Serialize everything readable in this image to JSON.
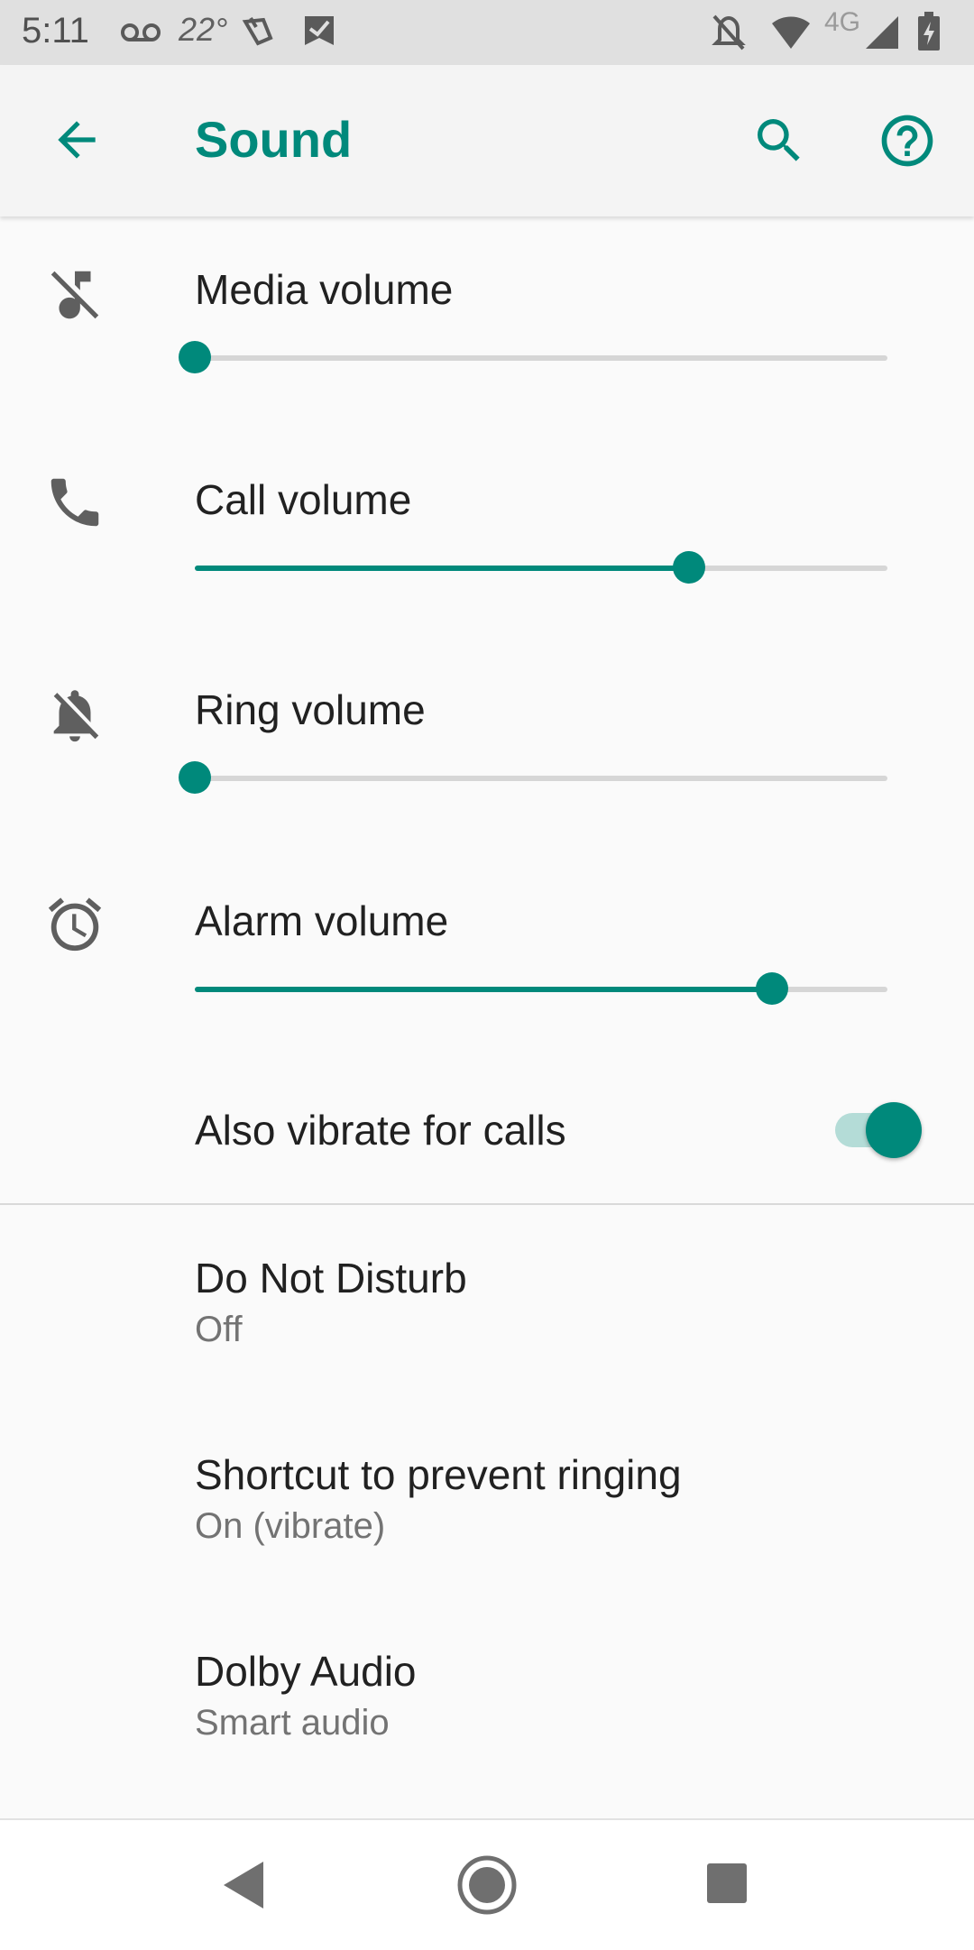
{
  "status_bar": {
    "time": "5:11",
    "temperature": "22°",
    "network_type": "4G",
    "icons": [
      "voicemail-icon",
      "weather-icon",
      "alert-icon",
      "task-icon",
      "notifications-off-icon",
      "wifi-icon",
      "signal-icon",
      "battery-charging-icon"
    ]
  },
  "app_bar": {
    "title": "Sound",
    "icons": [
      "back-arrow-icon",
      "search-icon",
      "help-icon"
    ]
  },
  "sliders": [
    {
      "label": "Media volume",
      "icon": "music-off-icon",
      "level": 0.0
    },
    {
      "label": "Call volume",
      "icon": "phone-icon",
      "level": 0.714
    },
    {
      "label": "Ring volume",
      "icon": "bell-off-icon",
      "level": 0.0
    },
    {
      "label": "Alarm volume",
      "icon": "alarm-clock-icon",
      "level": 0.833
    }
  ],
  "vibrate_toggle": {
    "label": "Also vibrate for calls",
    "on": true
  },
  "preferences": [
    {
      "title": "Do Not Disturb",
      "summary": "Off"
    },
    {
      "title": "Shortcut to prevent ringing",
      "summary": "On (vibrate)"
    },
    {
      "title": "Dolby Audio",
      "summary": "Smart audio"
    }
  ],
  "nav_bar": {
    "icons": [
      "nav-back-icon",
      "nav-home-icon",
      "nav-recents-icon"
    ]
  },
  "colors": {
    "accent": "#00897b",
    "accent_light": "#b4dcd7",
    "track": "#d6d6d6"
  }
}
